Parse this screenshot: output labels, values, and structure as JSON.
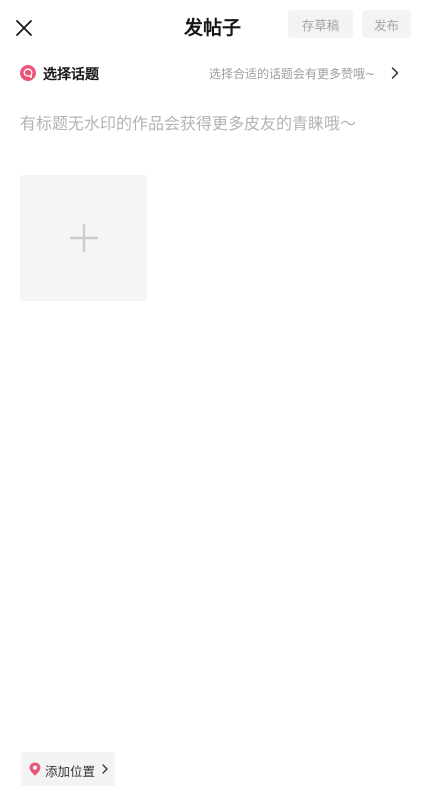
{
  "header": {
    "title": "发帖子",
    "draft_label": "存草稿",
    "publish_label": "发布",
    "close_icon": "close-icon"
  },
  "topic": {
    "label": "选择话题",
    "hint": "选择合适的话题会有更多赞哦~",
    "icon": "topic-icon",
    "chevron_icon": "chevron-right-icon"
  },
  "post": {
    "title_placeholder": "有标题无水印的作品会获得更多皮友的青睐哦～",
    "title_value": ""
  },
  "media": {
    "add_icon": "plus-icon"
  },
  "location": {
    "label": "添加位置",
    "icon": "location-pin-icon",
    "chevron_icon": "chevron-right-icon"
  },
  "colors": {
    "accent": "#e8577a",
    "button_bg": "#f3f3f3",
    "button_text": "#a3a3a3",
    "placeholder_text": "#b3b3b3",
    "tile_bg": "#f5f5f5"
  }
}
